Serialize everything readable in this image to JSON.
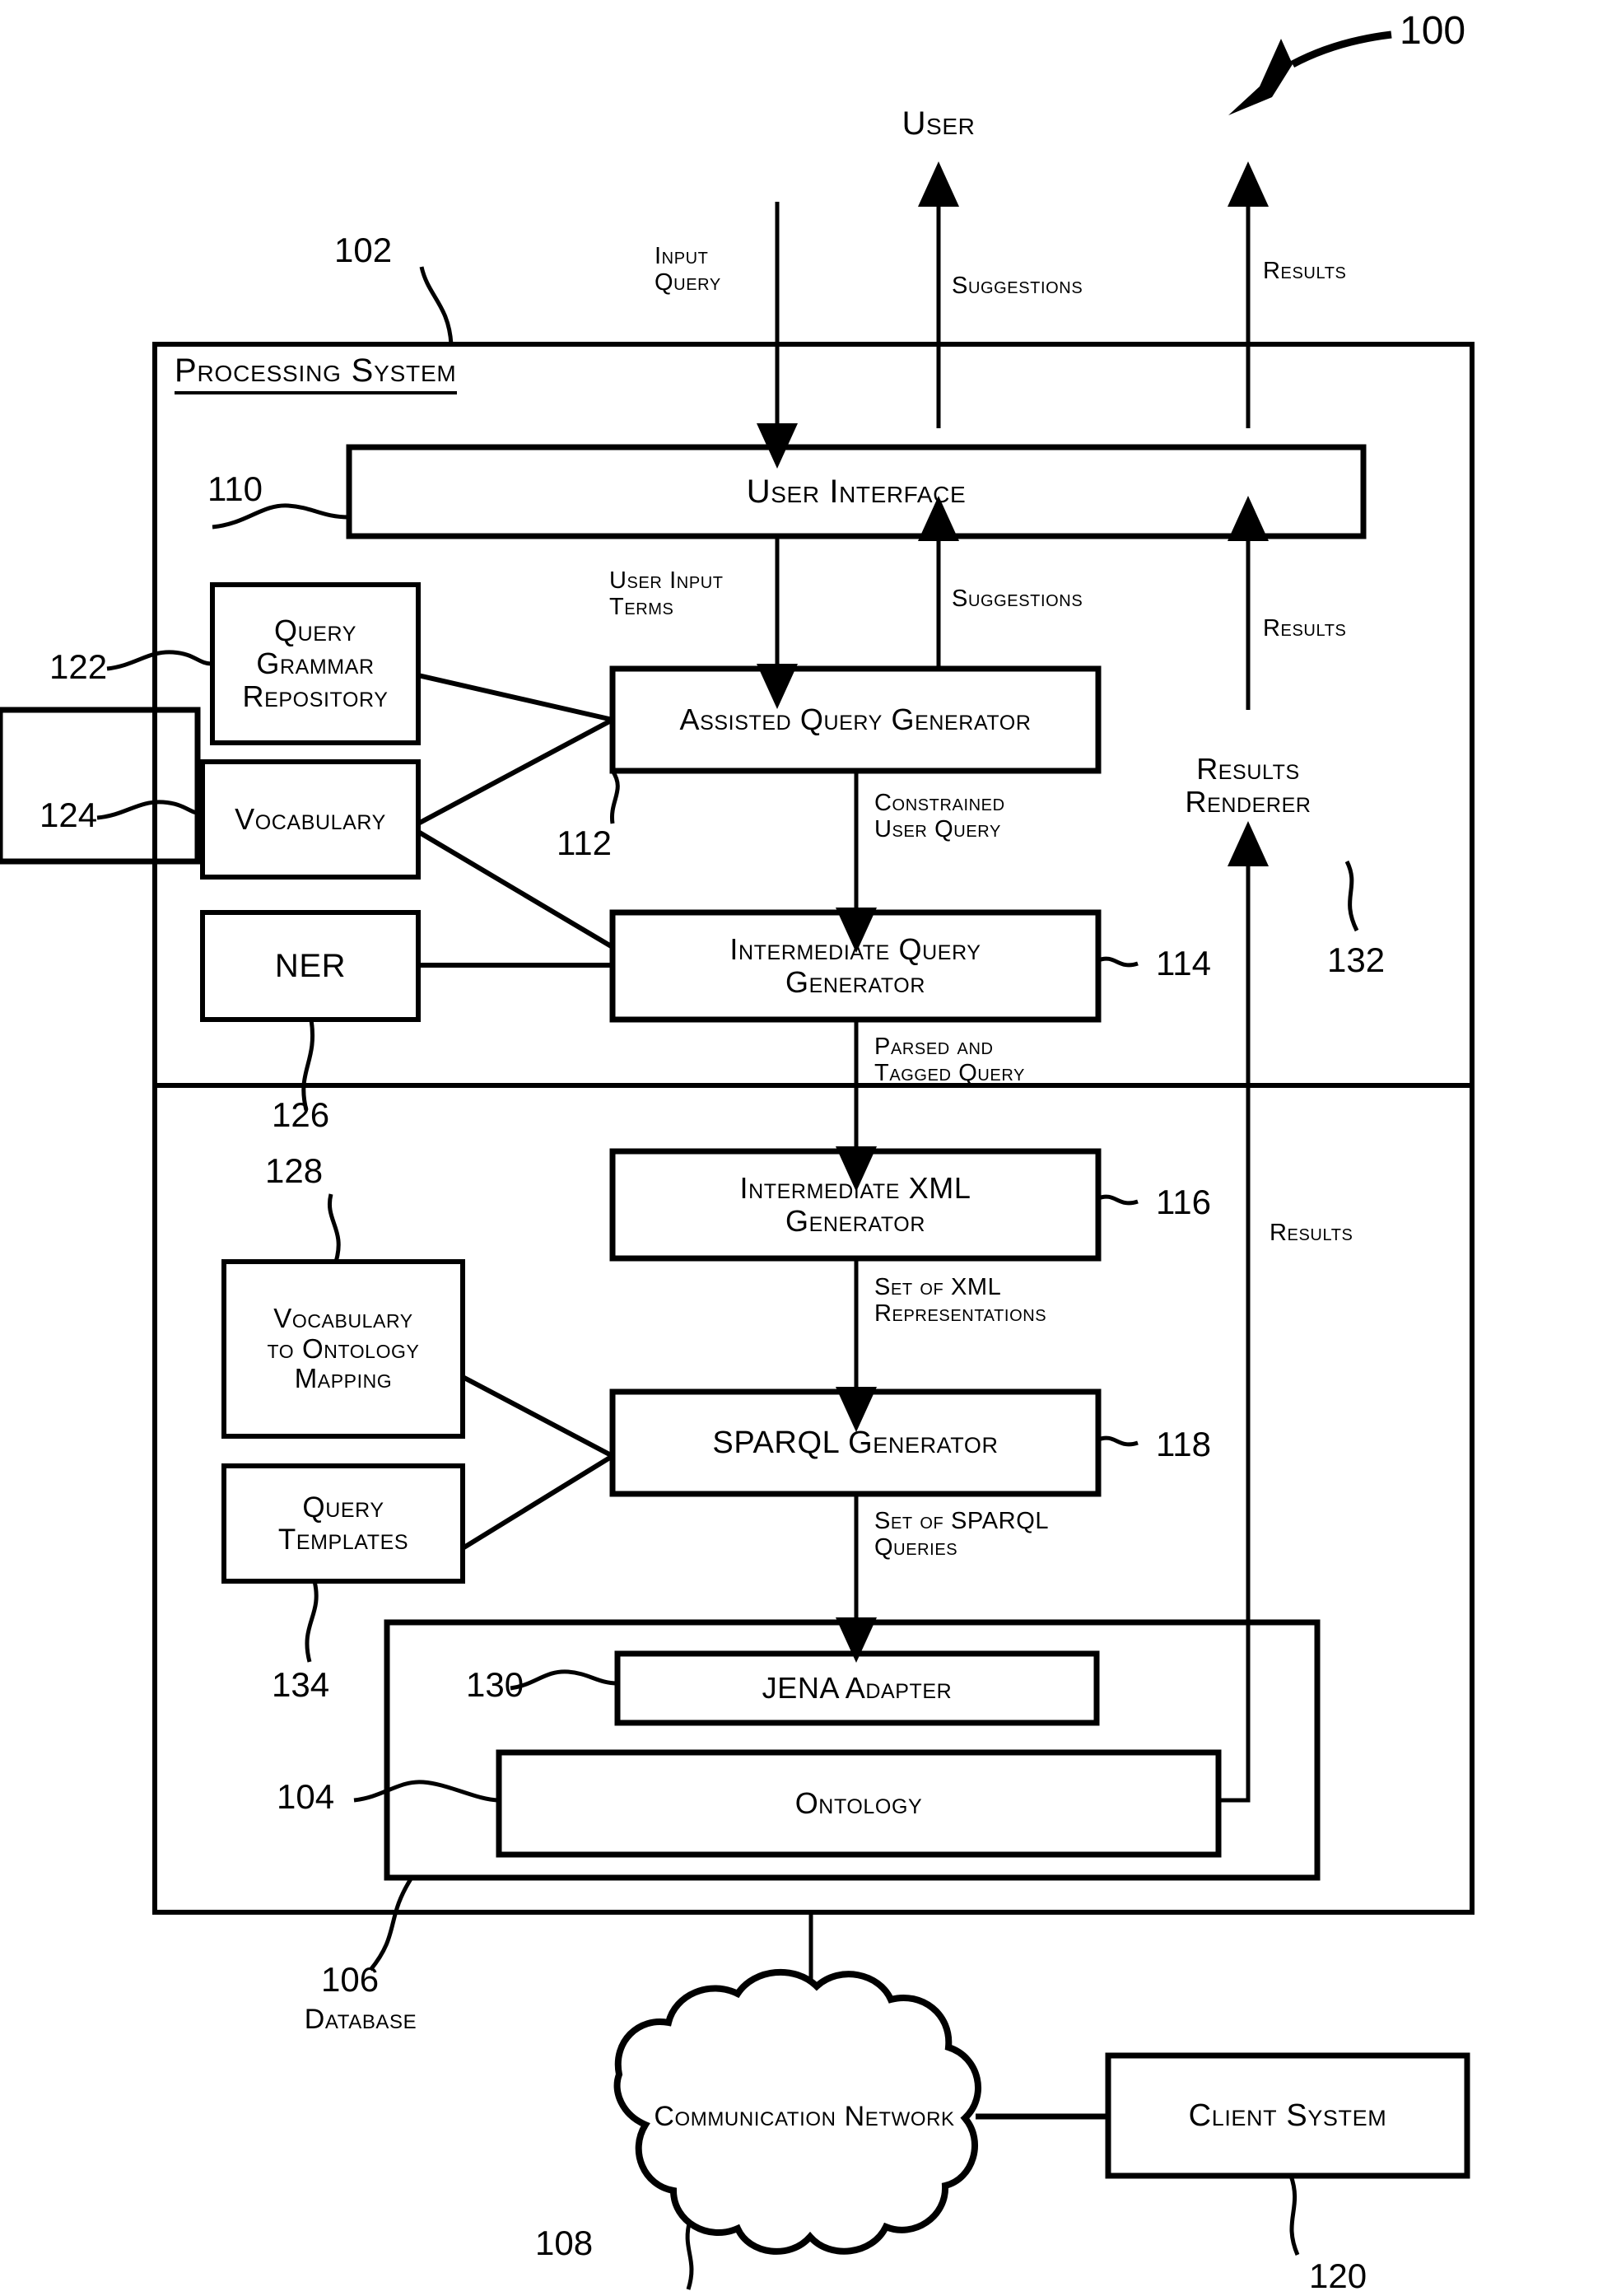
{
  "figure": {
    "ref_number": "100"
  },
  "actors": {
    "user_label": "User"
  },
  "system": {
    "title": "Processing System",
    "ref": "102"
  },
  "boxes": {
    "user_interface": {
      "label": "User Interface",
      "ref": "110"
    },
    "assisted_query_gen": {
      "label": "Assisted Query Generator",
      "ref": "112"
    },
    "intermediate_query_gen": {
      "label": "Intermediate Query\nGenerator",
      "ref": "114"
    },
    "intermediate_xml_gen": {
      "label": "Intermediate XML\nGenerator",
      "ref": "116"
    },
    "sparql_gen": {
      "label": "SPARQL Generator",
      "ref": "118"
    },
    "results_renderer": {
      "label": "Results\nRenderer",
      "ref": "132"
    },
    "query_grammar_repo": {
      "label": "Query\nGrammar\nRepository",
      "ref": "122"
    },
    "vocabulary": {
      "label": "Vocabulary",
      "ref": "124"
    },
    "ner": {
      "label": "NER",
      "ref": "126"
    },
    "vocab_to_ontology": {
      "label": "Vocabulary\nto Ontology\nMapping",
      "ref": "128"
    },
    "query_templates": {
      "label": "Query\nTemplates",
      "ref": "134"
    },
    "jena_adapter": {
      "label": "JENA Adapter",
      "ref": "130"
    },
    "ontology": {
      "label": "Ontology",
      "ref": "104"
    },
    "database": {
      "label": "Database",
      "ref": "106"
    },
    "communication_network": {
      "label": "Communication Network",
      "ref": "108"
    },
    "client_system": {
      "label": "Client System",
      "ref": "120"
    }
  },
  "flows": {
    "input_query": "Input\nQuery",
    "suggestions_top": "Suggestions",
    "results_top": "Results",
    "user_input_terms": "User Input\nTerms",
    "suggestions_mid": "Suggestions",
    "results_renderer_in": "Results",
    "constrained_user_query": "Constrained\nUser Query",
    "parsed_tagged_query": "Parsed and\nTagged Query",
    "set_of_xml": "Set of XML\nRepresentations",
    "set_of_sparql": "Set of SPARQL\nQueries",
    "results_right": "Results"
  },
  "colors": {
    "stroke": "#000000",
    "background": "#ffffff"
  }
}
